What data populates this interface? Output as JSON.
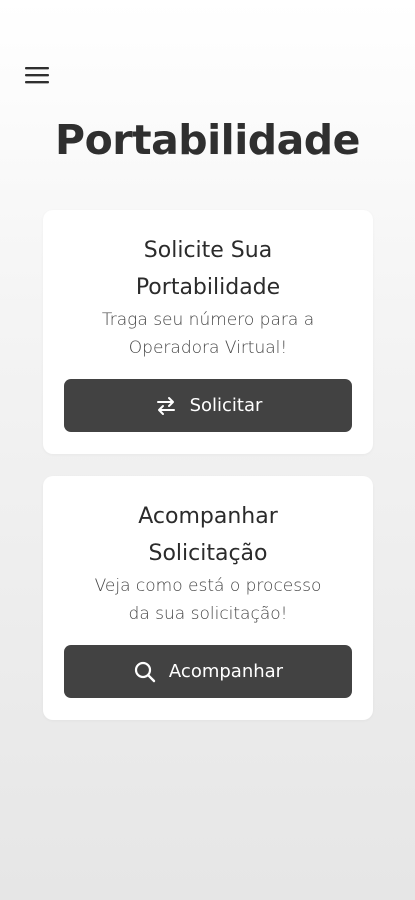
{
  "header": {
    "menu_icon": "hamburger-menu-icon"
  },
  "page": {
    "title": "Portabilidade"
  },
  "cards": [
    {
      "title_line1": "Solicite Sua",
      "title_line2": "Portabilidade",
      "desc_line1": "Traga seu número para a",
      "desc_line2": "Operadora Virtual!",
      "button_label": "Solicitar",
      "button_icon": "swap-arrows-icon"
    },
    {
      "title_line1": "Acompanhar",
      "title_line2": "Solicitação",
      "desc_line1": "Veja como está o processo",
      "desc_line2": "da sua solicitação!",
      "button_label": "Acompanhar",
      "button_icon": "search-icon"
    }
  ],
  "colors": {
    "button_bg": "#424242",
    "text": "#2f2f2f",
    "card_bg": "#ffffff"
  }
}
